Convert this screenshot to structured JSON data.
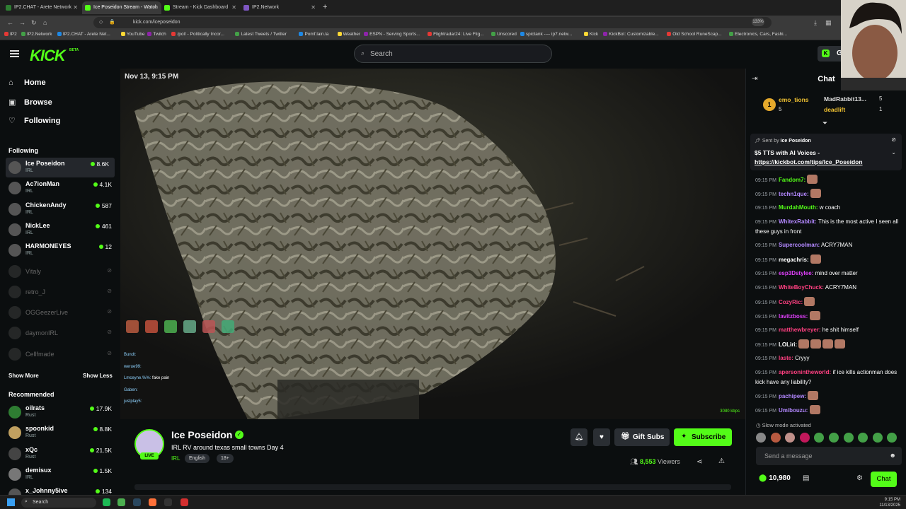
{
  "browser": {
    "tabs": [
      {
        "label": "IP2.CHAT - Arete Network",
        "color": "#2e7d32"
      },
      {
        "label": "Ice Poseidon Stream - Watch",
        "color": "#53fc18"
      },
      {
        "label": "Stream - Kick Dashboard",
        "color": "#53fc18"
      },
      {
        "label": "IP2.Network",
        "color": "#7e57c2"
      }
    ],
    "url": "kick.com/iceposeidon",
    "zoom": "133%",
    "bookmarks": [
      "IP2",
      "IP2.Network",
      "IP2.CHAT - Arete Net...",
      "YouTube",
      "Twitch",
      "/pol/ - Politically Incor...",
      "Latest Tweets / Twitter",
      "Pomf.lain.la",
      "Weather",
      "ESPN - Serving Sports...",
      "Flightradar24: Live Flig...",
      "Unscored",
      "spictank ---- ip7.netw...",
      "Kick",
      "KickBot: Customizable...",
      "Old School RuneScap...",
      "Electronics, Cars, Fashi..."
    ]
  },
  "header": {
    "logo": "KICK",
    "logo_beta": "BETA",
    "search_placeholder": "Search",
    "get_label": "Get"
  },
  "sidebar": {
    "nav": [
      {
        "label": "Home",
        "icon": "home-icon"
      },
      {
        "label": "Browse",
        "icon": "compass-icon"
      },
      {
        "label": "Following",
        "icon": "heart-icon"
      }
    ],
    "following_title": "Following",
    "following": [
      {
        "name": "Ice Poseidon",
        "category": "IRL",
        "viewers": "8.6K"
      },
      {
        "name": "Ac7ionMan",
        "category": "IRL",
        "viewers": "4.1K"
      },
      {
        "name": "ChickenAndy",
        "category": "IRL",
        "viewers": "587"
      },
      {
        "name": "NickLee",
        "category": "IRL",
        "viewers": "461"
      },
      {
        "name": "HARMONEYES",
        "category": "IRL",
        "viewers": "12"
      },
      {
        "name": "Vitaly",
        "category": "",
        "viewers": ""
      },
      {
        "name": "retro_J",
        "category": "",
        "viewers": ""
      },
      {
        "name": "OGGeezerLive",
        "category": "",
        "viewers": ""
      },
      {
        "name": "daymonIRL",
        "category": "",
        "viewers": ""
      },
      {
        "name": "Cellfmade",
        "category": "",
        "viewers": ""
      }
    ],
    "show_more": "Show More",
    "show_less": "Show Less",
    "recommended_title": "Recommended",
    "recommended": [
      {
        "name": "oilrats",
        "category": "Rust",
        "viewers": "17.9K"
      },
      {
        "name": "spoonkid",
        "category": "Rust",
        "viewers": "8.8K"
      },
      {
        "name": "xQc",
        "category": "Rust",
        "viewers": "21.5K"
      },
      {
        "name": "demisux",
        "category": "IRL",
        "viewers": "1.5K"
      },
      {
        "name": "x_Johnny5ive",
        "category": "",
        "viewers": "134"
      }
    ]
  },
  "video": {
    "timestamp": "Nov 13, 9:15 PM",
    "bitrate": "3080 kbps",
    "overlay_chat": [
      {
        "user": "Bundt:",
        "text": ""
      },
      {
        "user": "werue99:",
        "text": ""
      },
      {
        "user": "Lmceyne.%%:",
        "text": "fake pain"
      },
      {
        "user": "Gaben:",
        "text": ""
      },
      {
        "user": "justplay5:",
        "text": ""
      }
    ]
  },
  "stream": {
    "name": "Ice Poseidon",
    "title": "IRL RV around texas small towns Day 4",
    "category": "IRL",
    "tags": [
      "English",
      "18+"
    ],
    "live_label": "LIVE",
    "gift_subs_label": "Gift Subs",
    "subscribe_label": "Subscribe",
    "viewers_count": "8,553",
    "viewers_label": "Viewers"
  },
  "chat": {
    "title": "Chat",
    "leaderboard": [
      {
        "rank": "1",
        "name": "emo_tions",
        "count": "5"
      },
      {
        "rank": "",
        "name": "MadRabbit13...",
        "count": "5"
      },
      {
        "rank": "",
        "name": "deadlift",
        "count": "1"
      }
    ],
    "pinned_sent_by": "Sent by",
    "pinned_user": "Ice Poseidon",
    "pinned_text": "$5 TTS with AI Voices - ",
    "pinned_link": "https://kickbot.com/tips/Ice_Poseidon",
    "messages": [
      {
        "time": "09:15 PM",
        "user": "Fandom7:",
        "color": "#53fc18",
        "text": "",
        "emotes": 1
      },
      {
        "time": "09:15 PM",
        "user": "techn1que:",
        "color": "#b388ff",
        "text": "",
        "emotes": 1
      },
      {
        "time": "09:15 PM",
        "user": "MurdahMouth:",
        "color": "#53fc18",
        "text": "w coach",
        "emotes": 0
      },
      {
        "time": "09:15 PM",
        "user": "WhitexRabbit:",
        "color": "#b388ff",
        "text": "This is the most active I seen all these guys in front",
        "emotes": 0
      },
      {
        "time": "09:15 PM",
        "user": "Supercoolman:",
        "color": "#b388ff",
        "text": "ACRY7MAN",
        "emotes": 0
      },
      {
        "time": "09:15 PM",
        "user": "megachris:",
        "color": "#ffffff",
        "text": "",
        "emotes": 1
      },
      {
        "time": "09:15 PM",
        "user": "esp3Dstylee:",
        "color": "#e040fb",
        "text": "mind over matter",
        "emotes": 0
      },
      {
        "time": "09:15 PM",
        "user": "WhiteBoyChuck:",
        "color": "#ff4081",
        "text": "ACRY7MAN",
        "emotes": 0
      },
      {
        "time": "09:15 PM",
        "user": "CozyRic:",
        "color": "#ff4081",
        "text": "",
        "emotes": 1
      },
      {
        "time": "09:15 PM",
        "user": "lavitzboss:",
        "color": "#e040fb",
        "text": "",
        "emotes": 1
      },
      {
        "time": "09:15 PM",
        "user": "matthewbreyer:",
        "color": "#ff4081",
        "text": "he shit himself",
        "emotes": 0
      },
      {
        "time": "09:15 PM",
        "user": "LOLiri:",
        "color": "#ffffff",
        "text": "",
        "emotes": 4
      },
      {
        "time": "09:15 PM",
        "user": "laste:",
        "color": "#ff4081",
        "text": "Cryyy",
        "emotes": 0
      },
      {
        "time": "09:15 PM",
        "user": "apersonintheworld:",
        "color": "#ff4081",
        "text": "if ice kills actionman does kick have any liability?",
        "emotes": 0
      },
      {
        "time": "09:15 PM",
        "user": "pachipew:",
        "color": "#b388ff",
        "text": "",
        "emotes": 1
      },
      {
        "time": "09:15 PM",
        "user": "Umibouzu:",
        "color": "#b388ff",
        "text": "",
        "emotes": 1
      }
    ],
    "slow_mode": "Slow mode activated",
    "input_placeholder": "Send a message",
    "points": "10,980",
    "chat_button": "Chat"
  },
  "taskbar": {
    "search": "Search",
    "time": "9:15 PM",
    "date": "11/13/2025"
  },
  "colors": {
    "accent": "#53fc18",
    "background": "#0b0e0f"
  }
}
